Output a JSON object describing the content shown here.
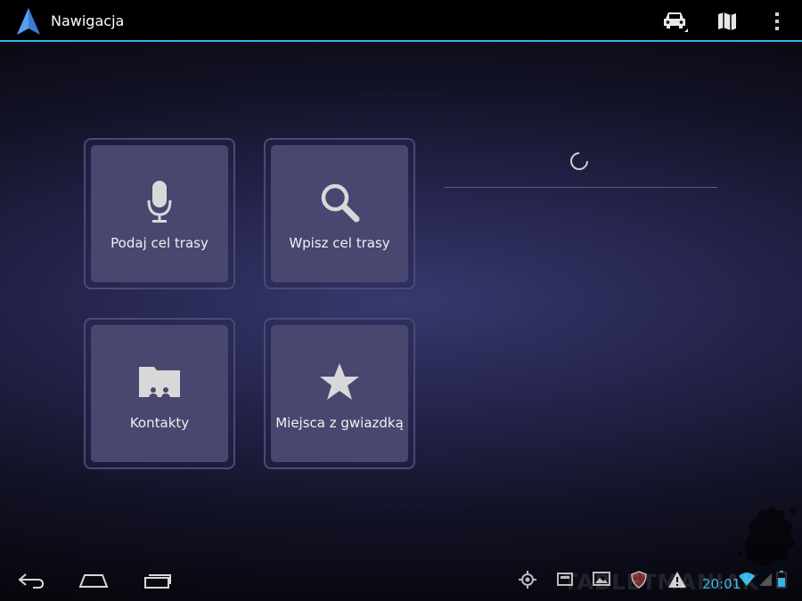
{
  "action_bar": {
    "title": "Nawigacja",
    "app_icon": "navigation-arrow-icon",
    "actions": [
      {
        "name": "car-mode-icon"
      },
      {
        "name": "map-icon"
      },
      {
        "name": "overflow-menu-icon"
      }
    ]
  },
  "tiles": [
    {
      "label": "Podaj cel trasy",
      "icon": "microphone-icon"
    },
    {
      "label": "Wpisz cel trasy",
      "icon": "search-icon"
    },
    {
      "label": "Kontakty",
      "icon": "contacts-icon"
    },
    {
      "label": "Miejsca z gwiazdką",
      "icon": "star-icon"
    }
  ],
  "system_bar": {
    "clock": "20:01",
    "watermark": "TABLETMANIAK",
    "nav": [
      "back-icon",
      "home-icon",
      "recent-apps-icon"
    ],
    "status_icons": [
      "gps-icon",
      "sd-card-icon",
      "gallery-icon",
      "shield-icon",
      "warning-icon",
      "wifi-icon",
      "signal-icon",
      "battery-icon"
    ]
  },
  "colors": {
    "accent": "#33b5e5",
    "tile": "#474770",
    "background_center": "#38386e"
  }
}
